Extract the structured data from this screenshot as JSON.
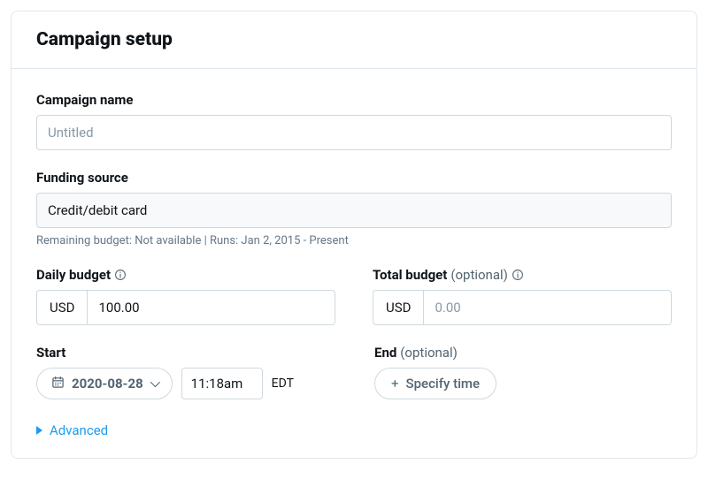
{
  "header": {
    "title": "Campaign setup"
  },
  "campaign_name": {
    "label": "Campaign name",
    "placeholder": "Untitled",
    "value": ""
  },
  "funding_source": {
    "label": "Funding source",
    "value": "Credit/debit card",
    "helper": "Remaining budget: Not available | Runs: Jan 2, 2015 - Present"
  },
  "daily_budget": {
    "label": "Daily budget",
    "currency": "USD",
    "value": "100.00"
  },
  "total_budget": {
    "label": "Total budget",
    "optional": "(optional)",
    "currency": "USD",
    "placeholder": "0.00",
    "value": ""
  },
  "start": {
    "label": "Start",
    "date": "2020-08-28",
    "time": "11:18am",
    "tz": "EDT"
  },
  "end": {
    "label": "End",
    "optional": "(optional)",
    "specify_label": "Specify time"
  },
  "advanced": {
    "label": "Advanced"
  }
}
